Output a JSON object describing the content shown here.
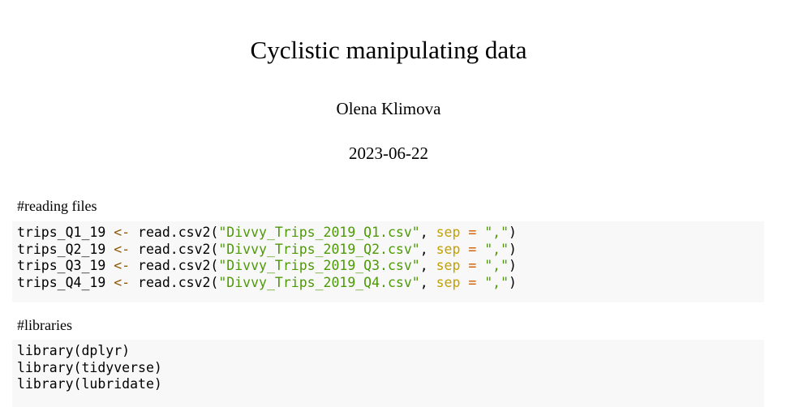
{
  "title": "Cyclistic manipulating data",
  "author": "Olena Klimova",
  "date": "2023-06-22",
  "sections": [
    {
      "comment": "#reading files",
      "reads": [
        {
          "var": "trips_Q1_19",
          "file": "\"Divvy_Trips_2019_Q1.csv\""
        },
        {
          "var": "trips_Q2_19",
          "file": "\"Divvy_Trips_2019_Q2.csv\""
        },
        {
          "var": "trips_Q3_19",
          "file": "\"Divvy_Trips_2019_Q3.csv\""
        },
        {
          "var": "trips_Q4_19",
          "file": "\"Divvy_Trips_2019_Q4.csv\""
        }
      ],
      "assign": " <- ",
      "func": "read.csv2(",
      "comma": ", ",
      "arg": "sep",
      "eq": " = ",
      "sep_val": "\",\"",
      "close": ")"
    },
    {
      "comment": "#libraries",
      "lines": [
        "library(dplyr)",
        "library(tidyverse)",
        "library(lubridate)"
      ]
    }
  ]
}
